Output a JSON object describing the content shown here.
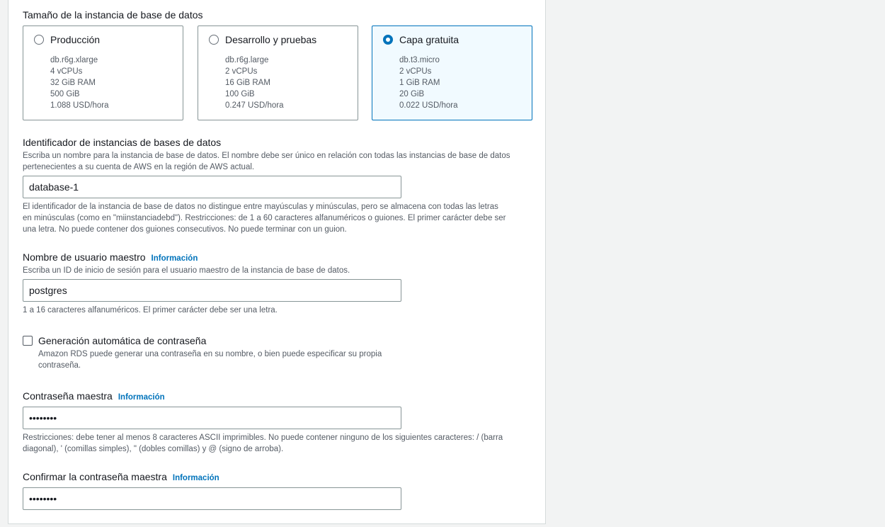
{
  "instance_size": {
    "title": "Tamaño de la instancia de base de datos",
    "options": [
      {
        "name": "Producción",
        "selected": false,
        "specs": [
          "db.r6g.xlarge",
          "4 vCPUs",
          "32 GiB RAM",
          "500 GiB",
          "1.088 USD/hora"
        ]
      },
      {
        "name": "Desarrollo y pruebas",
        "selected": false,
        "specs": [
          "db.r6g.large",
          "2 vCPUs",
          "16 GiB RAM",
          "100 GiB",
          "0.247 USD/hora"
        ]
      },
      {
        "name": "Capa gratuita",
        "selected": true,
        "specs": [
          "db.t3.micro",
          "2 vCPUs",
          "1 GiB RAM",
          "20 GiB",
          "0.022 USD/hora"
        ]
      }
    ]
  },
  "identifier": {
    "title": "Identificador de instancias de bases de datos",
    "description_line1": "Escriba un nombre para la instancia de base de datos. El nombre debe ser único en relación con todas las instancias de base de datos",
    "description_line2": "pertenecientes a su cuenta de AWS en la región de AWS actual.",
    "value": "database-1",
    "hint_line1": "El identificador de la instancia de base de datos no distingue entre mayúsculas y minúsculas, pero se almacena con todas las letras",
    "hint_line2": "en minúsculas (como en \"miinstanciadebd\"). Restricciones: de 1 a 60 caracteres alfanuméricos o guiones. El primer carácter debe ser",
    "hint_line3": "una letra. No puede contener dos guiones consecutivos. No puede terminar con un guion."
  },
  "master_username": {
    "title": "Nombre de usuario maestro",
    "info": "Información",
    "description": "Escriba un ID de inicio de sesión para el usuario maestro de la instancia de base de datos.",
    "value": "postgres",
    "hint": "1 a 16 caracteres alfanuméricos. El primer carácter debe ser una letra."
  },
  "auto_password": {
    "label": "Generación automática de contraseña",
    "checked": false,
    "description_line1": "Amazon RDS puede generar una contraseña en su nombre, o bien puede especificar su propia",
    "description_line2": "contraseña."
  },
  "master_password": {
    "title": "Contraseña maestra",
    "info": "Información",
    "value": "••••••••",
    "hint_line1": "Restricciones: debe tener al menos 8 caracteres ASCII imprimibles. No puede contener ninguno de los siguientes caracteres: / (barra",
    "hint_line2": "diagonal), ' (comillas simples), \" (dobles comillas) y @ (signo de arroba)."
  },
  "confirm_password": {
    "title": "Confirmar la contraseña maestra",
    "info": "Información",
    "value": "••••••••"
  },
  "colors": {
    "accent": "#0073bb",
    "selected_tile_bg": "#f1faff",
    "text": "#16191f",
    "muted_text": "#545b64",
    "border": "#879596"
  }
}
